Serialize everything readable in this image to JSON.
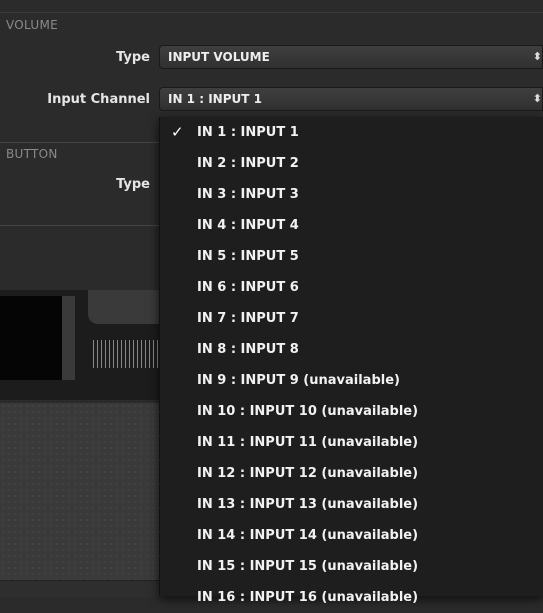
{
  "volume": {
    "section_title": "VOLUME",
    "type_label": "Type",
    "type_value": "INPUT VOLUME",
    "channel_label": "Input Channel",
    "channel_value": "IN 1 : INPUT 1"
  },
  "button": {
    "section_title": "BUTTON",
    "type_label": "Type"
  },
  "dropdown": {
    "check_glyph": "✓",
    "items": [
      "IN 1 : INPUT 1",
      "IN 2 : INPUT 2",
      "IN 3 : INPUT 3",
      "IN 4 : INPUT 4",
      "IN 5 : INPUT 5",
      "IN 6 : INPUT 6",
      "IN 7 : INPUT 7",
      "IN 8 : INPUT 8",
      "IN 9 : INPUT 9 (unavailable)",
      "IN 10 : INPUT 10 (unavailable)",
      "IN 11 : INPUT 11 (unavailable)",
      "IN 12 : INPUT 12 (unavailable)",
      "IN 13 : INPUT 13 (unavailable)",
      "IN 14 : INPUT 14 (unavailable)",
      "IN 15 : INPUT 15 (unavailable)",
      "IN 16 : INPUT 16 (unavailable)"
    ],
    "selected_index": 0
  },
  "icons": {
    "select_arrows": "updown-arrows-icon",
    "check": "checkmark-icon"
  }
}
